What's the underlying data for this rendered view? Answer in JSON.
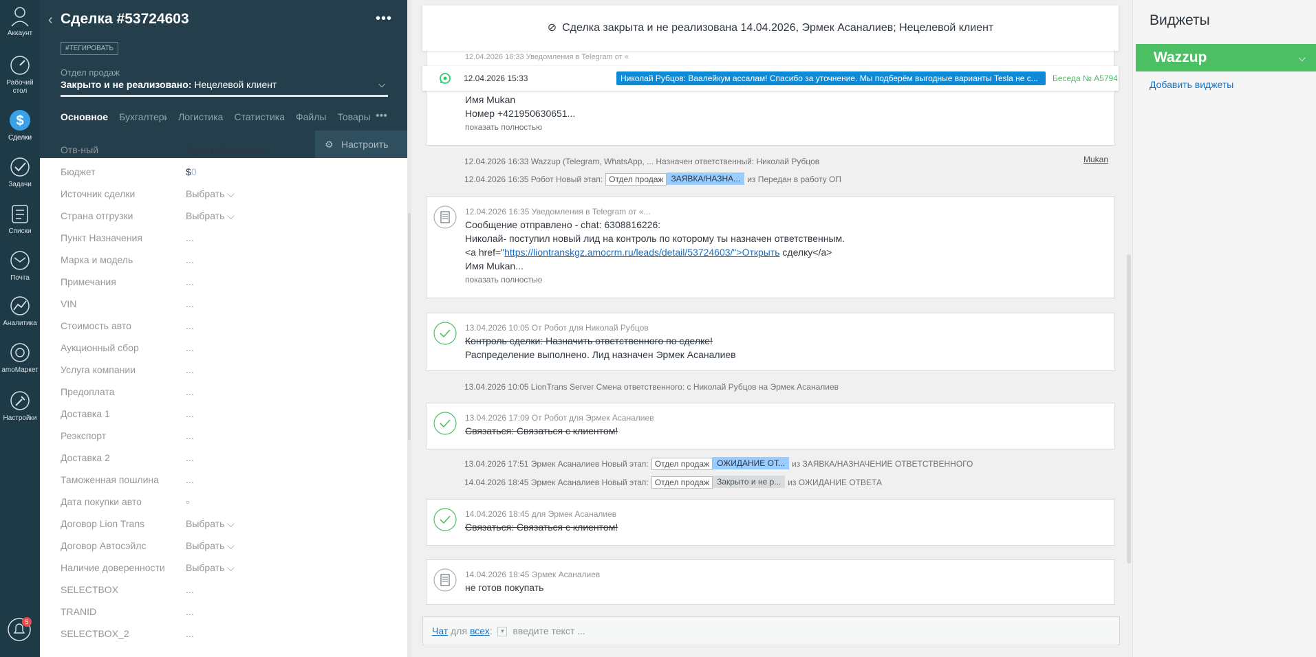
{
  "nav": {
    "items": [
      {
        "label": "Аккаунт",
        "icon": "user-icon"
      },
      {
        "label": "Рабочий стол",
        "icon": "dashboard-icon"
      },
      {
        "label": "Сделки",
        "icon": "deals-icon"
      },
      {
        "label": "Задачи",
        "icon": "tasks-icon"
      },
      {
        "label": "Списки",
        "icon": "lists-icon"
      },
      {
        "label": "Почта",
        "icon": "mail-icon"
      },
      {
        "label": "Аналитика",
        "icon": "analytics-icon"
      },
      {
        "label": "amoМаркет",
        "icon": "market-icon"
      },
      {
        "label": "Настройки",
        "icon": "settings-icon"
      }
    ],
    "notifications_count": "5"
  },
  "card": {
    "title": "Сделка #53724603",
    "tag_button": "#ТЕГИРОВАТЬ",
    "pipeline": "Отдел продаж",
    "status_prefix": "Закрыто и не реализовано:",
    "status_value": "Нецелевой клиент",
    "tabs": [
      "Основное",
      "Бухгалтерия",
      "Логистика",
      "Статистика",
      "Файлы",
      "Товары"
    ],
    "setup_button": "Настроить",
    "fields": [
      {
        "label": "Отв-ный",
        "value": "Эрмек Асаналиев"
      },
      {
        "label": "Бюджет",
        "value": "$",
        "extra": "0"
      },
      {
        "label": "Источник сделки",
        "value": "Выбрать ⌵"
      },
      {
        "label": "Страна отгрузки",
        "value": "Выбрать ⌵"
      },
      {
        "label": "Пункт Назначения",
        "value": "..."
      },
      {
        "label": "Марка и модель",
        "value": "..."
      },
      {
        "label": "Примечания",
        "value": "..."
      },
      {
        "label": "VIN",
        "value": "..."
      },
      {
        "label": "Стоимость авто",
        "value": "..."
      },
      {
        "label": "Аукционный сбор",
        "value": "..."
      },
      {
        "label": "Услуга компании",
        "value": "..."
      },
      {
        "label": "Предоплата",
        "value": "..."
      },
      {
        "label": "Доставка 1",
        "value": "..."
      },
      {
        "label": "Реэкспорт",
        "value": "..."
      },
      {
        "label": "Доставка 2",
        "value": "..."
      },
      {
        "label": "Таможенная пошлина",
        "value": "..."
      },
      {
        "label": "Дата покупки авто",
        "value": "▫"
      },
      {
        "label": "Договор Lion Trans",
        "value": "Выбрать ⌵"
      },
      {
        "label": "Договор Автосэйлс",
        "value": "Выбрать ⌵"
      },
      {
        "label": "Наличие довереności",
        "value": "Выбрать ⌵"
      },
      {
        "label": "SELECTBOX",
        "value": "..."
      },
      {
        "label": "TRANID",
        "value": "..."
      },
      {
        "label": "SELECTBOX_2",
        "value": "..."
      }
    ]
  },
  "feed": {
    "closed_banner": "Сделка закрыта и не реализована 14.04.2026, Эрмек Асаналиев; Нецелевой клиент",
    "ghost_header": "12.04.2026 16:33 Уведомления в Telegram от «",
    "wa_bar": {
      "date": "12.04.2026 15:33",
      "message": "Николай Рубцов: Ваалейкум ассалам! Спасибо за уточнение. Мы подберём выгодные варианты Tesla не с...",
      "conversation": "Беседа № A5794"
    },
    "note1": {
      "line1": "Имя Mukan",
      "line2": "Номер +421950630651...",
      "more": "показать полностью"
    },
    "sys1": {
      "text": "12.04.2026 16:33 Wazzup (Telegram, WhatsApp, ... Назначен ответственный: Николай Рубцов",
      "author": "Mukan"
    },
    "sys2": {
      "text": "12.04.2026 16:35 Робот Новый этап:",
      "stage": "Отдел продаж",
      "pill": "ЗАЯВКА/НАЗНА...",
      "tail": "из Передан в работу ОП"
    },
    "note2": {
      "meta": "12.04.2026 16:35 Уведомления в Telegram от «...",
      "line1": "Сообщение отправлено - chat: 6308816226:",
      "line2": "Николай- поступил новый лид на контроль по которому ты назначен ответственным.",
      "line3_pre": "<a href=\"",
      "link": "https://liontranskgz.amocrm.ru/leads/detail/53724603/\">Открыть",
      "line3_post": " сделку</a>",
      "line4": "Имя Mukan...",
      "more": "показать полностью"
    },
    "task1": {
      "meta": "13.04.2026 10:05  От Робот для Николай Рубцов",
      "line1": "Контроль сделки: Назначить ответственного по сделке!",
      "line2": "Распределение выполнено. Лид назначен Эрмек Асаналиев"
    },
    "sys3": {
      "text": "13.04.2026 10:05 LionTrans Server Смена ответственного: с Николай Рубцов на Эрмек Асаналиев"
    },
    "task2": {
      "meta": "13.04.2026 17:09  От Робот для Эрмек Асаналиев",
      "line1": "Связаться: Связаться с клиентом!"
    },
    "sys4": {
      "text": "13.04.2026 17:51 Эрмек Асаналиев Новый этап:",
      "stage": "Отдел продаж",
      "pill": "ОЖИДАНИЕ ОТ...",
      "tail": "из ЗАЯВКА/НАЗНАЧЕНИЕ ОТВЕТСТВЕННОГО"
    },
    "sys5": {
      "text": "14.04.2026 18:45 Эрмек Асаналиев Новый этап:",
      "stage": "Отдел продаж",
      "pill": "Закрыто и не р...",
      "tail": "из ОЖИДАНИЕ ОТВЕТА"
    },
    "task3": {
      "meta": "14.04.2026 18:45  для Эрмек Асаналиев",
      "line1": "Связаться: Связаться с клиентом!"
    },
    "note3": {
      "meta": "14.04.2026 18:45 Эрмек Асаналиев",
      "line1": "не готов покупать"
    },
    "composer": {
      "chat": "Чат",
      "for": "для",
      "all": "всех",
      "colon": ":",
      "placeholder": "введите текст ..."
    }
  },
  "widgets": {
    "title": "Виджеты",
    "wazzup": "Wazzup",
    "add": "Добавить виджеты"
  },
  "colors": {
    "nav_bg": "#1f3a47",
    "header_bg": "#243e4b",
    "accent_green": "#4cbf65",
    "accent_blue": "#0f8ad6",
    "link": "#1571c8"
  }
}
